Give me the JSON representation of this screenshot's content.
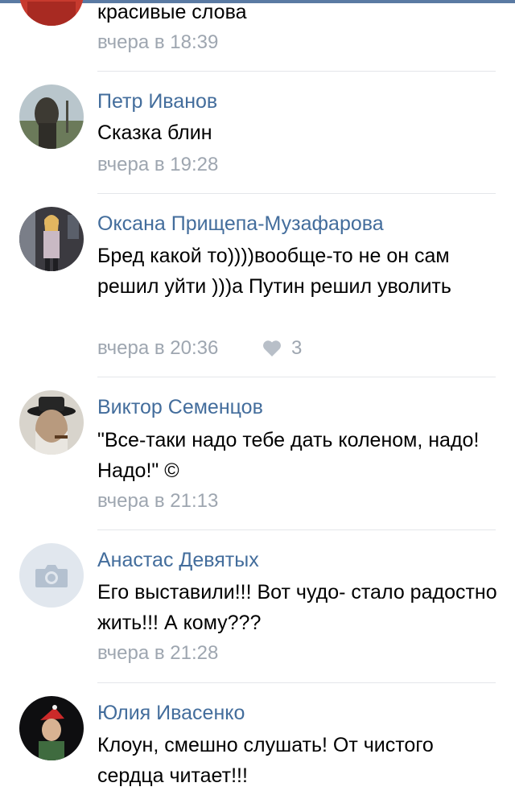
{
  "accent_color": "#436d9c",
  "comments": [
    {
      "author": "",
      "text": "красивые слова",
      "time": "вчера в 18:39",
      "avatar_icon": "user-photo-red"
    },
    {
      "author": "Петр Иванов",
      "text": "Сказка блин",
      "time": "вчера в 19:28",
      "avatar_icon": "user-photo-statue"
    },
    {
      "author": "Оксана Прищепа-Музафарова",
      "text": "Бред какой то))))вообще-то не он сам решил уйти )))а Путин решил уволить",
      "time": "вчера в 20:36",
      "likes": "3",
      "avatar_icon": "user-photo-woman"
    },
    {
      "author": "Виктор Семенцов",
      "text": "\"Все-таки надо тебе дать коленом, надо! Надо!\" ©",
      "time": "вчера в 21:13",
      "avatar_icon": "user-photo-man-hat"
    },
    {
      "author": "Анастас Девятых",
      "text": "Его выставили!!! Вот чудо- стало радостно жить!!! А кому???",
      "time": "вчера в 21:28",
      "avatar_icon": "camera-placeholder-icon"
    },
    {
      "author": "Юлия Ивасенко",
      "text": "Клоун, смешно слушать! От чистого сердца читает!!!",
      "time": "",
      "avatar_icon": "user-photo-santa-hat"
    }
  ]
}
